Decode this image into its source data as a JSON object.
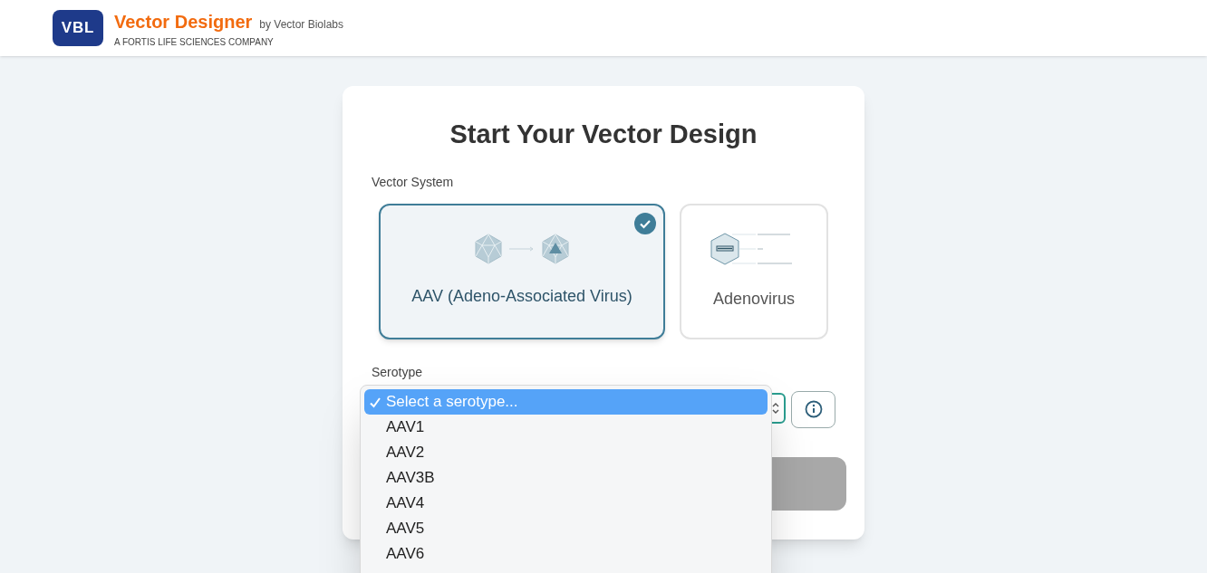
{
  "header": {
    "logo": "VBL",
    "title": "Vector Designer",
    "byline": "by Vector Biolabs",
    "tagline": "A FORTIS LIFE SCIENCES COMPANY"
  },
  "card": {
    "title": "Start Your Vector Design",
    "vector_system_label": "Vector System",
    "vector_systems": [
      {
        "label": "AAV (Adeno-Associated Virus)",
        "kind": "aav",
        "selected": true
      },
      {
        "label": "Adenovirus",
        "kind": "adenovirus",
        "selected": false
      }
    ],
    "serotype_label": "Serotype",
    "serotype_options": [
      {
        "label": "Select a serotype...",
        "selected": true
      },
      {
        "label": "AAV1",
        "selected": false
      },
      {
        "label": "AAV2",
        "selected": false
      },
      {
        "label": "AAV3B",
        "selected": false
      },
      {
        "label": "AAV4",
        "selected": false
      },
      {
        "label": "AAV5",
        "selected": false
      },
      {
        "label": "AAV6",
        "selected": false
      }
    ]
  }
}
